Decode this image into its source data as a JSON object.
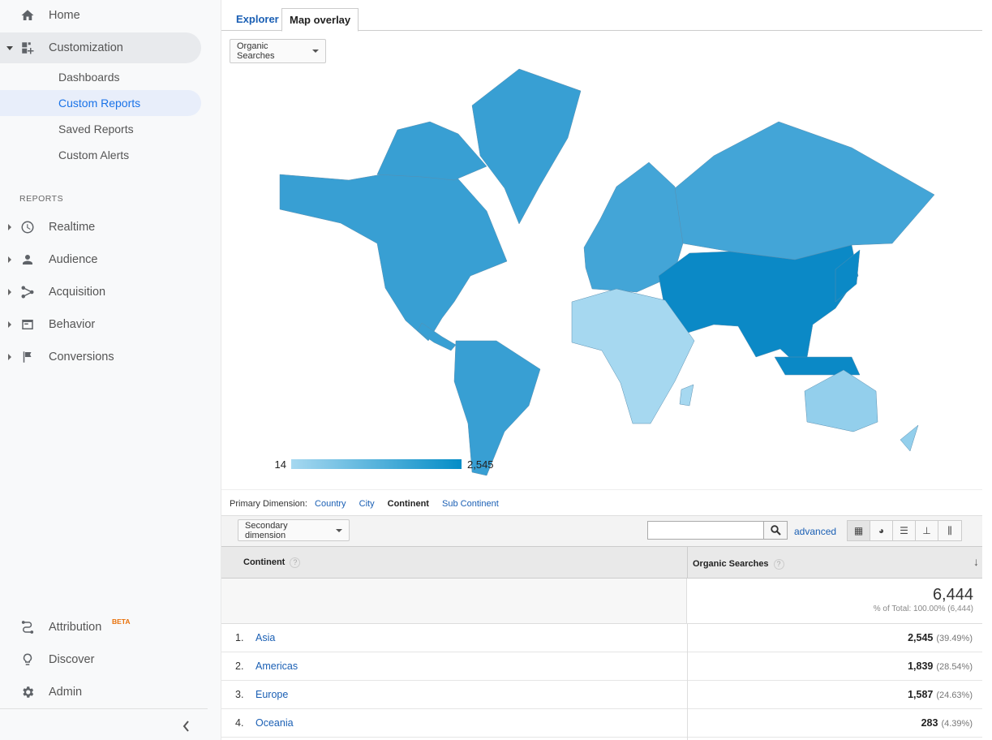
{
  "sidebar": {
    "home": "Home",
    "customization": "Customization",
    "sub_items": [
      "Dashboards",
      "Custom Reports",
      "Saved Reports",
      "Custom Alerts"
    ],
    "reports_heading": "REPORTS",
    "reports": [
      "Realtime",
      "Audience",
      "Acquisition",
      "Behavior",
      "Conversions"
    ],
    "attribution": "Attribution",
    "beta": "BETA",
    "discover": "Discover",
    "admin": "Admin"
  },
  "tabs": {
    "explorer": "Explorer",
    "map_overlay": "Map overlay"
  },
  "metric_select": "Organic Searches",
  "map": {
    "legend_min": "14",
    "legend_max": "2,545",
    "colors": {
      "min": "#a6d8f0",
      "max": "#058dc7",
      "Asia": "#0b89c6",
      "Americas": "#389fd3",
      "Europe": "#43a5d7",
      "Oceania": "#93cfec",
      "Africa": "#a6d8f0"
    }
  },
  "primary_dimension": {
    "label": "Primary Dimension:",
    "options": [
      "Country",
      "City",
      "Continent",
      "Sub Continent"
    ],
    "active": "Continent"
  },
  "toolbar": {
    "secondary_dimension": "Secondary dimension",
    "search_value": "",
    "advanced": "advanced"
  },
  "table": {
    "col1": "Continent",
    "col2": "Organic Searches",
    "total": "6,444",
    "total_sub": "% of Total: 100.00% (6,444)",
    "rows": [
      {
        "n": "1.",
        "name": "Asia",
        "value": "2,545",
        "pct": "(39.49%)"
      },
      {
        "n": "2.",
        "name": "Americas",
        "value": "1,839",
        "pct": "(28.54%)"
      },
      {
        "n": "3.",
        "name": "Europe",
        "value": "1,587",
        "pct": "(24.63%)"
      },
      {
        "n": "4.",
        "name": "Oceania",
        "value": "283",
        "pct": "(4.39%)"
      }
    ]
  }
}
